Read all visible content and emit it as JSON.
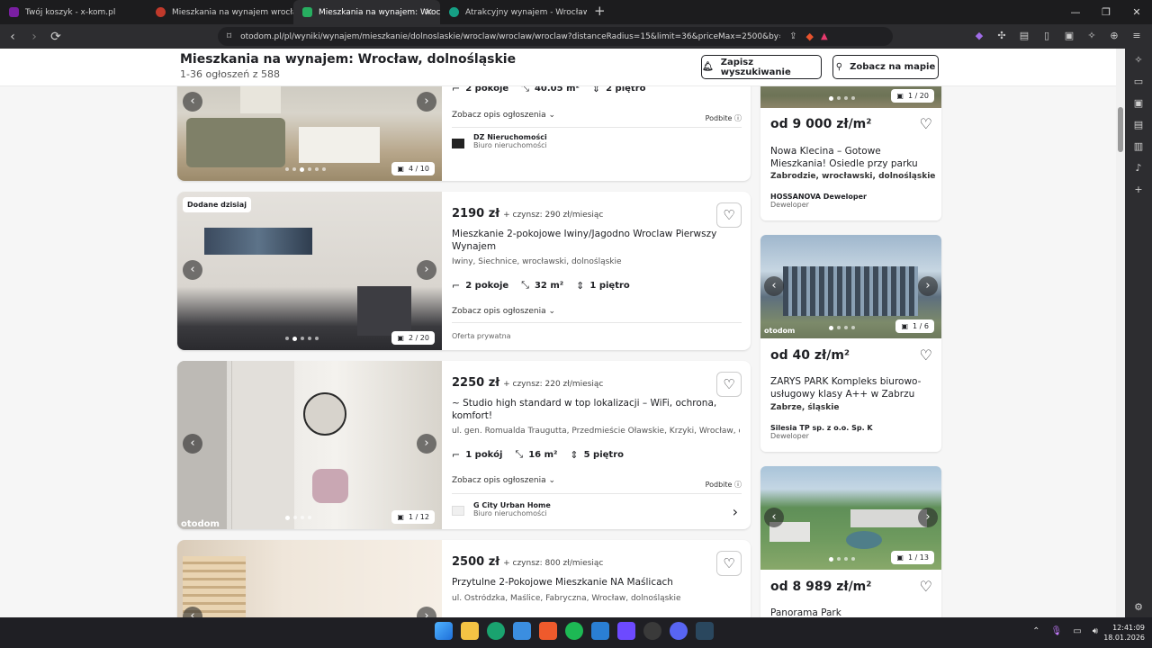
{
  "browser": {
    "tabs": [
      {
        "title": "Twój koszyk - x-kom.pl",
        "color": "#7a1fa2"
      },
      {
        "title": "Mieszkania na wynajem wrocław - Br",
        "color": "#c0392b"
      },
      {
        "title": "Mieszkania na wynajem: Wrocław",
        "color": "#27ae60"
      },
      {
        "title": "Atrakcyjny wynajem - Wrocław - spra",
        "color": "#16a085"
      }
    ],
    "url": "otodom.pl/pl/wyniki/wynajem/mieszkanie/dolnoslaskie/wroclaw/wroclaw/wroclaw?distanceRadius=15&limit=36&priceMax=2500&by=DEFAULT&direction..."
  },
  "header": {
    "title": "Mieszkania na wynajem: Wrocław, dolnośląskie",
    "count": "1-36 ogłoszeń z 588",
    "save_search": "Zapisz wyszukiwanie",
    "map": "Zobacz na mapie"
  },
  "listings": [
    {
      "rooms": "2 pokoje",
      "area": "40.05 m²",
      "floor": "2 piętro",
      "desc": "Zobacz opis ogłoszenia",
      "promo": "Podbite",
      "agency": "DZ Nieruchomości",
      "agency_type": "Biuro nieruchomości",
      "counter": "4 / 10"
    },
    {
      "badge": "Dodane dzisiaj",
      "price": "2190 zł",
      "rent": "+ czynsz: 290 zł/miesiąc",
      "title": "Mieszkanie 2-pokojowe Iwiny/Jagodno Wroclaw Pierwszy Wynajem",
      "address": "Iwiny, Siechnice, wrocławski, dolnośląskie",
      "rooms": "2 pokoje",
      "area": "32 m²",
      "floor": "1 piętro",
      "desc": "Zobacz opis ogłoszenia",
      "seller": "Oferta prywatna",
      "counter": "2 / 20"
    },
    {
      "price": "2250 zł",
      "rent": "+ czynsz: 220 zł/miesiąc",
      "title": "~ Studio high standard w top lokalizacji – WiFi, ochrona, komfort!",
      "address": "ul. gen. Romualda Traugutta, Przedmieście Oławskie, Krzyki, Wrocław, d...",
      "rooms": "1 pokój",
      "area": "16 m²",
      "floor": "5 piętro",
      "desc": "Zobacz opis ogłoszenia",
      "promo": "Podbite",
      "agency": "G City Urban Home",
      "agency_type": "Biuro nieruchomości",
      "counter": "1 / 12"
    },
    {
      "price": "2500 zł",
      "rent": "+ czynsz: 800 zł/miesiąc",
      "title": "Przytulne 2-Pokojowe Mieszkanie NA Maślicach",
      "address": "ul. Ostródzka, Maślice, Fabryczna, Wrocław, dolnośląskie"
    }
  ],
  "investments": [
    {
      "counter": "1 / 20",
      "price": "od 9 000 zł/m²",
      "title": "Nowa Klecina – Gotowe Mieszkania! Osiedle przy parku",
      "location": "Zabrodzie, wrocławski, dolnośląskie",
      "developer": "HOSSANOVA Deweloper",
      "dev_type": "Deweloper"
    },
    {
      "counter": "1 / 6",
      "price": "od 40 zł/m²",
      "title": "ZARYS PARK Kompleks biurowo-usługowy klasy A++ w Zabrzu",
      "location": "Zabrze, śląskie",
      "developer": "Silesia TP sp. z o.o. Sp. K",
      "dev_type": "Deweloper",
      "watermark": "otodom"
    },
    {
      "counter": "1 / 13",
      "price": "od 8 989 zł/m²",
      "title": "Panorama Park"
    }
  ],
  "watermark": "otodom",
  "clock": {
    "time": "12:41:09",
    "date": "18.01.2026"
  }
}
